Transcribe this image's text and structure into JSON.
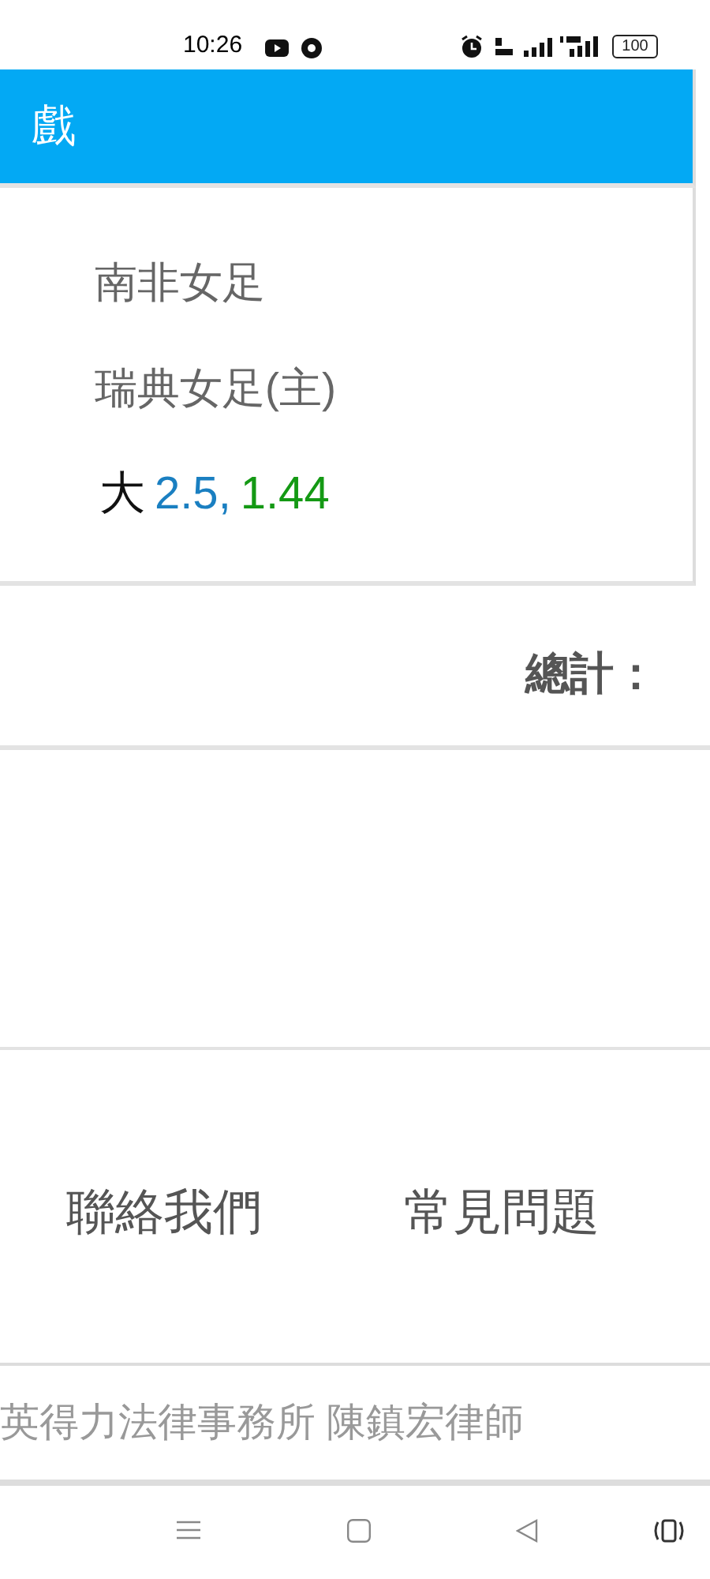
{
  "status_bar": {
    "time": "10:26",
    "battery": "100"
  },
  "header": {
    "title": "戲"
  },
  "match": {
    "teams": [
      "南非女足",
      "瑞典女足(主)"
    ],
    "bet": [
      {
        "text": "大",
        "color": "#111111"
      },
      {
        "text": "2.5,",
        "color": "#1a7fc1"
      },
      {
        "text": "1.44",
        "color": "#149914"
      }
    ]
  },
  "total": {
    "label": "總計："
  },
  "links": [
    "聯絡我們",
    "常見問題"
  ],
  "footer": {
    "text": "英得力法律事務所 陳鎮宏律師"
  }
}
